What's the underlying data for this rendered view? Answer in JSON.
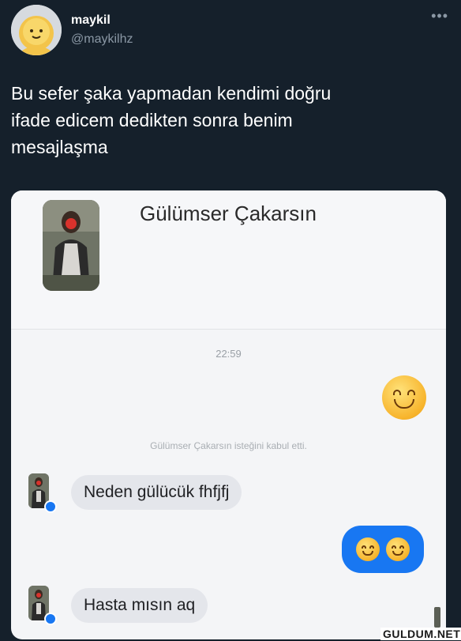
{
  "tweet": {
    "display_name": "maykil",
    "handle": "@maykilhz",
    "more_icon": "more-dots-icon",
    "text_lines": [
      "Bu sefer şaka yapmadan kendimi doğru",
      "ifade edicem dedikten sonra benim",
      "mesajlaşma"
    ]
  },
  "screenshot": {
    "contact_name": "Gülümser Çakarsın",
    "time": "22:59",
    "system_message": "Gülümser Çakarsın isteğini kabul etti.",
    "messages": [
      {
        "from": "sent",
        "content": "smiling-emoji"
      },
      {
        "from": "contact",
        "text": "Neden gülücük fhfjfj"
      },
      {
        "from": "sent",
        "content": "two-smiling-emojis"
      },
      {
        "from": "contact",
        "text": "Hasta mısın aq"
      }
    ],
    "accent_color": "#1877f2"
  },
  "watermark": "GULDUM.NET"
}
